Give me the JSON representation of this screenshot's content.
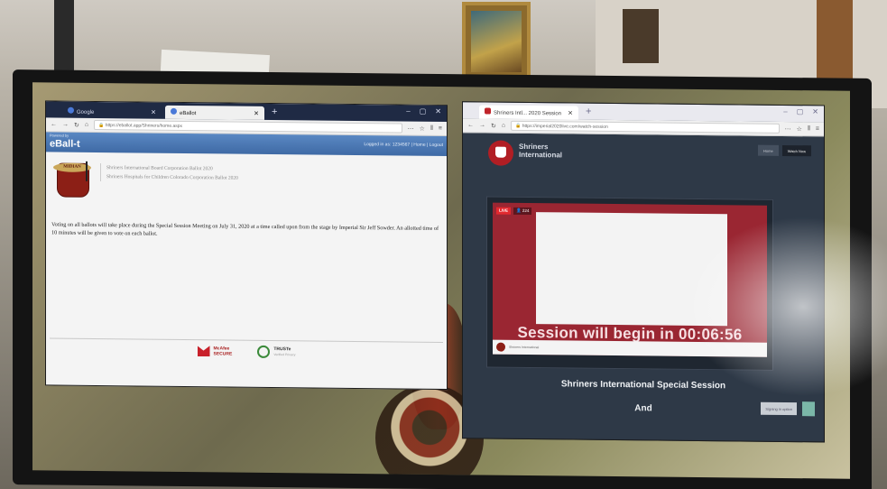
{
  "left_window": {
    "tabs": [
      {
        "label": "Google",
        "active": false
      },
      {
        "label": "eBallot",
        "active": true
      }
    ],
    "url": "https://eballot.app/Shriners/home.aspx",
    "header": {
      "powered_by": "Powered by",
      "logo": "eBall-t",
      "links": "Logged in as: 1234567 | Home | Logout"
    },
    "org": {
      "fez_text": "MIDIAN",
      "ballots": [
        "Shriners International Board Corporation Ballot 2020",
        "Shriners Hospitals for Children Colorado Corporation Ballot 2020"
      ]
    },
    "voting_note": "Voting on all ballots will take place during the Special Session Meeting on July 31, 2020 at a time called upon from the stage by Imperial Sir Jeff Sowder. An allotted time of 10 minutes will be given to vote on each ballot.",
    "badges": {
      "mcafee_title": "McAfee",
      "mcafee_sub": "SECURE",
      "truste_title": "TRUSTe",
      "truste_sub": "Verified Privacy"
    }
  },
  "right_window": {
    "tabs": [
      {
        "label": "Shriners Intl... 2020 Session",
        "active": true
      }
    ],
    "url": "https://imperial2020live.com/watch-session",
    "header": {
      "org_name_line1": "Shriners",
      "org_name_line2": "International",
      "btn_left": "Home",
      "btn_right": "Watch Now"
    },
    "video": {
      "live_label": "LIVE",
      "viewer_count": "224",
      "countdown": "Session will begin in 00:06:56",
      "channel_name": "Shriners International"
    },
    "session_title": "Shriners International Special Session",
    "session_and": "And",
    "signin_label": "Signing in option"
  },
  "colors": {
    "eballot_blue": "#4a7bb9",
    "shriners_red": "#b11e24",
    "video_red": "#9a2632",
    "session_bg": "#2e3947"
  }
}
